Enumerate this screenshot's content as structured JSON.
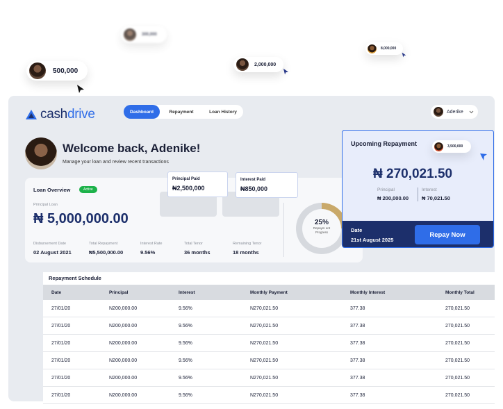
{
  "bubbles": [
    {
      "label": "500,000"
    },
    {
      "label": "2,000,000"
    },
    {
      "label": "300,000"
    },
    {
      "label": "8,000,000"
    },
    {
      "label": "3,500,000"
    }
  ],
  "brand": {
    "cash": "cash",
    "drive": "drive"
  },
  "nav": {
    "tabs": [
      "Dashboard",
      "Repayment",
      "Loan History"
    ],
    "active": "Dashboard"
  },
  "user": {
    "name": "Aderike"
  },
  "welcome": {
    "title": "Welcome back, Adenike!",
    "subtitle": "Manage your loan and review recent transactions"
  },
  "overview": {
    "title": "Loan Overview",
    "badge": "Active",
    "principal_label": "Principal Loan",
    "principal_amount": "₦ 5,000,000.00",
    "stats": [
      {
        "label": "Disbursement Date",
        "value": "02 August 2021"
      },
      {
        "label": "Total Repayment",
        "value": "₦5,500,000.00"
      },
      {
        "label": "Interest Rate",
        "value": "9.56%"
      },
      {
        "label": "Total Tenor",
        "value": "36 months"
      },
      {
        "label": "Remaining Tenor",
        "value": "18 months"
      }
    ],
    "progress": {
      "percent_text": "25%",
      "label": "Repaym ent Progress",
      "value": 0.25
    }
  },
  "mini_cards": {
    "principal_paid": {
      "label": "Principal Paid",
      "value": "₦2,500,000"
    },
    "interest_paid": {
      "label": "Interest Paid",
      "value": "₦850,000"
    }
  },
  "upcoming": {
    "title": "Upcoming Repayment",
    "amount": "₦ 270,021.50",
    "principal_label": "Principal",
    "principal_value": "₦ 200,000.00",
    "interest_label": "Interest",
    "interest_value": "₦ 70,021.50",
    "date_label": "Date",
    "date_value": "21st August 2025",
    "button": "Repay Now"
  },
  "schedule": {
    "title": "Repayment Schedule",
    "columns": [
      "Date",
      "Principal",
      "Interest",
      "Monthly Payment",
      "Monthly Interest",
      "Monthly Total"
    ],
    "rows": [
      [
        "27/01/20",
        "N200,000.00",
        "9.56%",
        "N270,021.50",
        "377.38",
        "270,021.50"
      ],
      [
        "27/01/20",
        "N200,000.00",
        "9.56%",
        "N270,021.50",
        "377.38",
        "270,021.50"
      ],
      [
        "27/01/20",
        "N200,000.00",
        "9.56%",
        "N270,021.50",
        "377.38",
        "270,021.50"
      ],
      [
        "27/01/20",
        "N200,000.00",
        "9.56%",
        "N270,021.50",
        "377.38",
        "270,021.50"
      ],
      [
        "27/01/20",
        "N200,000.00",
        "9.56%",
        "N270,021.50",
        "377.38",
        "270,021.50"
      ],
      [
        "27/01/20",
        "N200,000.00",
        "9.56%",
        "N270,021.50",
        "377.38",
        "270,021.50"
      ]
    ]
  },
  "colors": {
    "primary": "#2f6de8",
    "navy": "#1c2f6b",
    "success": "#1db24a",
    "progress": "#c9a96a"
  }
}
